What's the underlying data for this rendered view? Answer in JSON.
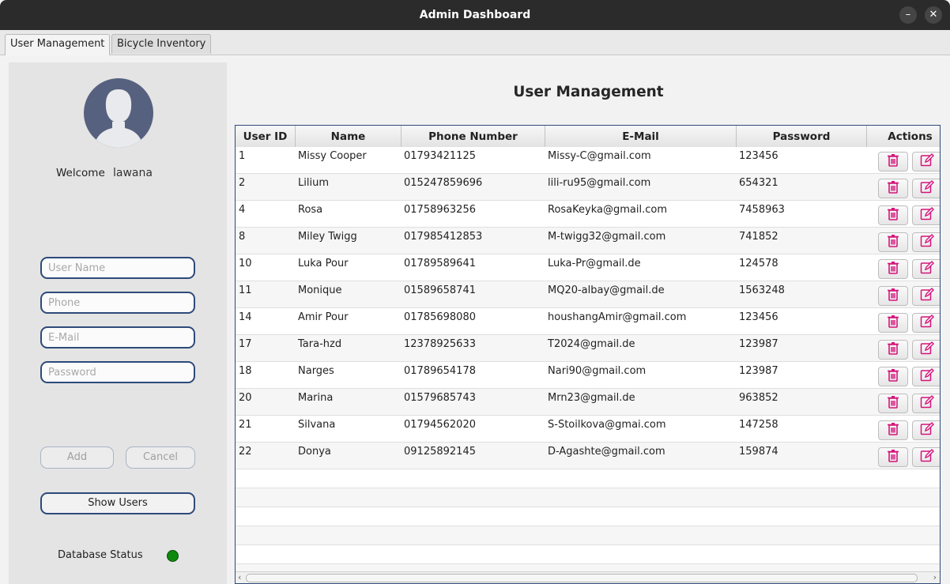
{
  "window": {
    "title": "Admin Dashboard",
    "minimize_icon": "minus",
    "close_icon": "x"
  },
  "tabs": [
    {
      "label": "User Management",
      "active": true
    },
    {
      "label": "Bicycle Inventory",
      "active": false
    }
  ],
  "sidebar": {
    "welcome_label": "Welcome",
    "username": "lawana",
    "fields": {
      "username_placeholder": "User Name",
      "phone_placeholder": "Phone",
      "email_placeholder": "E-Mail",
      "password_placeholder": "Password"
    },
    "add_label": "Add",
    "cancel_label": "Cancel",
    "show_users_label": "Show Users",
    "db_status_label": "Database Status",
    "db_status_color": "#0d8a0d"
  },
  "main": {
    "title": "User Management",
    "columns": [
      "User ID",
      "Name",
      "Phone Number",
      "E-Mail",
      "Password",
      "Actions"
    ],
    "rows": [
      {
        "id": "1",
        "name": "Missy Cooper",
        "phone": "01793421125",
        "email": "Missy-C@gmail.com",
        "password": "123456"
      },
      {
        "id": "2",
        "name": "Lilium",
        "phone": "015247859696",
        "email": "lili-ru95@gmail.com",
        "password": "654321"
      },
      {
        "id": "4",
        "name": "Rosa",
        "phone": "01758963256",
        "email": "RosaKeyka@gmail.com",
        "password": "7458963"
      },
      {
        "id": "8",
        "name": "Miley Twigg",
        "phone": "017985412853",
        "email": "M-twigg32@gmail.com",
        "password": "741852"
      },
      {
        "id": "10",
        "name": "Luka Pour",
        "phone": "01789589641",
        "email": "Luka-Pr@gmail.de",
        "password": "124578"
      },
      {
        "id": "11",
        "name": "Monique",
        "phone": "01589658741",
        "email": "MQ20-albay@gmail.de",
        "password": "1563248"
      },
      {
        "id": "14",
        "name": "Amir Pour",
        "phone": "01785698080",
        "email": "houshangAmir@gmail.com",
        "password": "123456"
      },
      {
        "id": "17",
        "name": "Tara-hzd",
        "phone": "12378925633",
        "email": "T2024@gmail.de",
        "password": "123987"
      },
      {
        "id": "18",
        "name": "Narges",
        "phone": "01789654178",
        "email": "Nari90@gmail.com",
        "password": "123987"
      },
      {
        "id": "20",
        "name": "Marina",
        "phone": "01579685743",
        "email": "Mrn23@gmail.de",
        "password": "963852"
      },
      {
        "id": "21",
        "name": "Silvana",
        "phone": "01794562020",
        "email": "S-Stoilkova@gmai.com",
        "password": "147258"
      },
      {
        "id": "22",
        "name": "Donya",
        "phone": "09125892145",
        "email": "D-Agashte@gmail.com",
        "password": "159874"
      }
    ],
    "action_icons": {
      "delete": "trash-icon",
      "edit": "edit-icon"
    },
    "accent_color": "#2e4a7a",
    "action_icon_color": "#d4147a"
  }
}
